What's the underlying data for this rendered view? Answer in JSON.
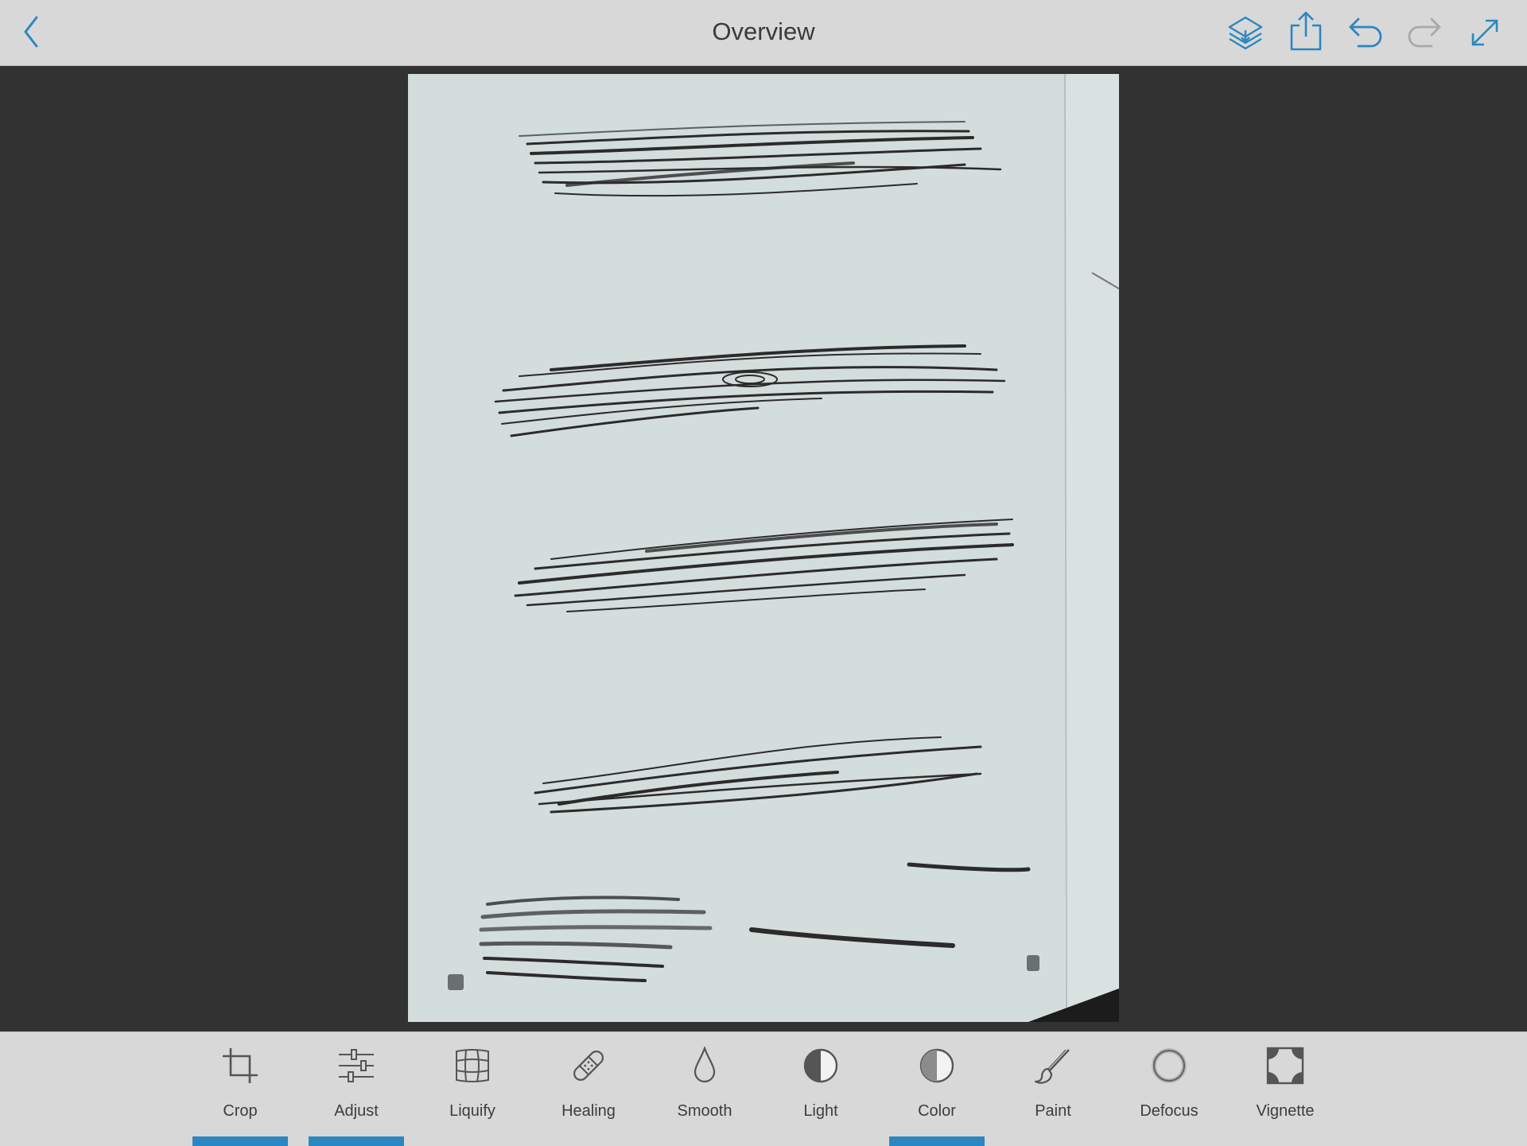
{
  "header": {
    "title": "Overview"
  },
  "icons": {
    "back": "chevron-left-icon",
    "layers": "layers-icon",
    "share": "share-icon",
    "undo": "undo-icon",
    "redo": "redo-icon",
    "expand": "expand-icon"
  },
  "colors": {
    "accent": "#2b87c0",
    "disabled": "#a9a9a9",
    "topbar": "#d8d8d8",
    "canvas": "#323232"
  },
  "toolbar": {
    "tools": [
      {
        "label": "Crop",
        "icon": "crop-icon",
        "active": true
      },
      {
        "label": "Adjust",
        "icon": "sliders-icon",
        "active": true
      },
      {
        "label": "Liquify",
        "icon": "grid-warp-icon",
        "active": false
      },
      {
        "label": "Healing",
        "icon": "bandage-icon",
        "active": false
      },
      {
        "label": "Smooth",
        "icon": "droplet-icon",
        "active": false
      },
      {
        "label": "Light",
        "icon": "half-circle-icon",
        "active": false
      },
      {
        "label": "Color",
        "icon": "half-circle-icon",
        "active": true
      },
      {
        "label": "Paint",
        "icon": "brush-icon",
        "active": false
      },
      {
        "label": "Defocus",
        "icon": "blur-circle-icon",
        "active": false
      },
      {
        "label": "Vignette",
        "icon": "vignette-icon",
        "active": false
      }
    ]
  }
}
